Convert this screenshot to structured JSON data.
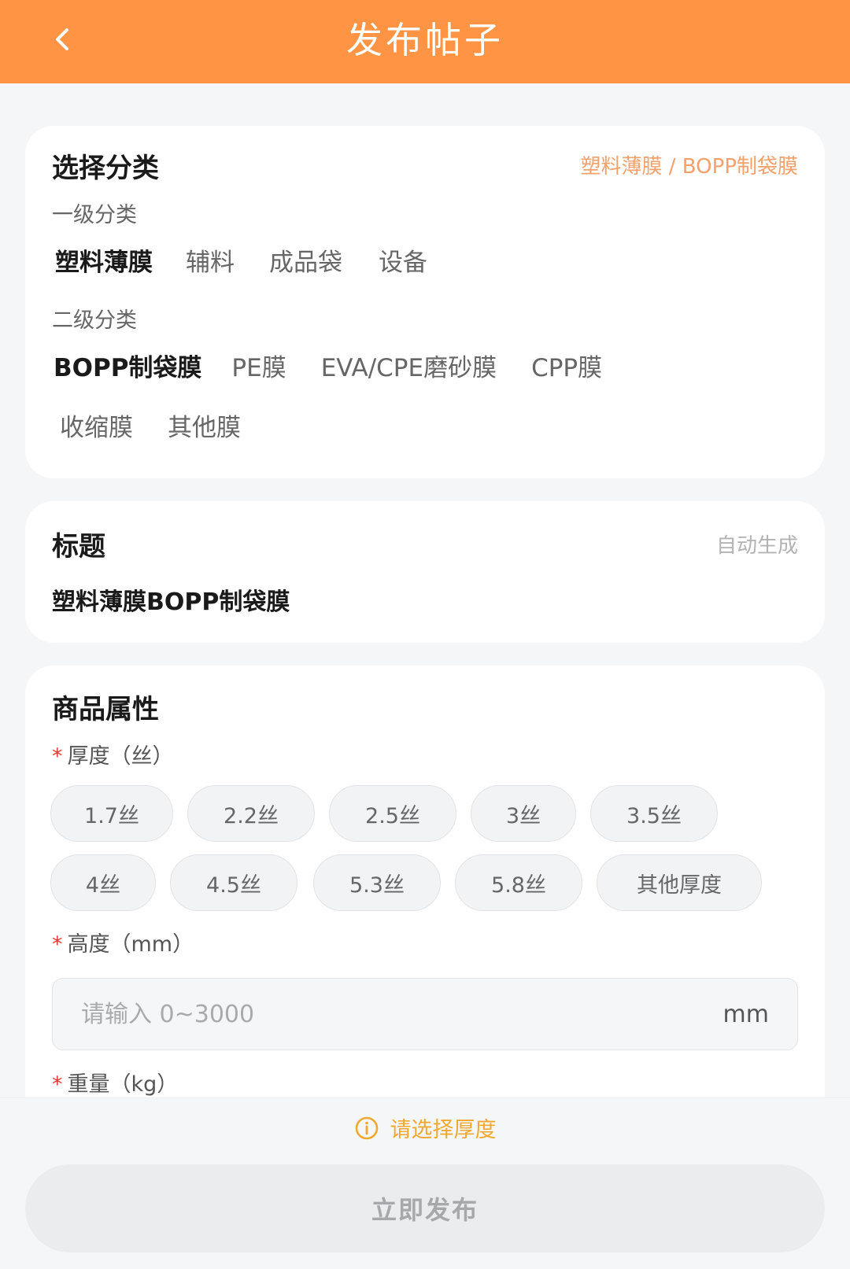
{
  "header": {
    "title": "发布帖子"
  },
  "category": {
    "title": "选择分类",
    "selected_path": "塑料薄膜 / BOPP制袋膜",
    "level1_label": "一级分类",
    "level1_items": [
      "塑料薄膜",
      "辅料",
      "成品袋",
      "设备"
    ],
    "level1_selected": "塑料薄膜",
    "level2_label": "二级分类",
    "level2_items": [
      "BOPP制袋膜",
      "PE膜",
      "EVA/CPE磨砂膜",
      "CPP膜",
      "收缩膜",
      "其他膜"
    ],
    "level2_selected": "BOPP制袋膜"
  },
  "title_card": {
    "title": "标题",
    "note": "自动生成",
    "value": "塑料薄膜BOPP制袋膜"
  },
  "attrs": {
    "title": "商品属性",
    "thickness_label": "厚度（丝）",
    "thickness_options": [
      "1.7丝",
      "2.2丝",
      "2.5丝",
      "3丝",
      "3.5丝",
      "4丝",
      "4.5丝",
      "5.3丝",
      "5.8丝",
      "其他厚度"
    ],
    "height_label": "高度（mm）",
    "height_placeholder": "请输入 0~3000",
    "height_unit": "mm",
    "weight_label": "重量（kg）",
    "required_mark": "*"
  },
  "bottom": {
    "hint": "请选择厚度",
    "publish_label": "立即发布"
  },
  "colors": {
    "brand": "#ff9445",
    "accent_text": "#f0a830",
    "required": "#e53935"
  }
}
